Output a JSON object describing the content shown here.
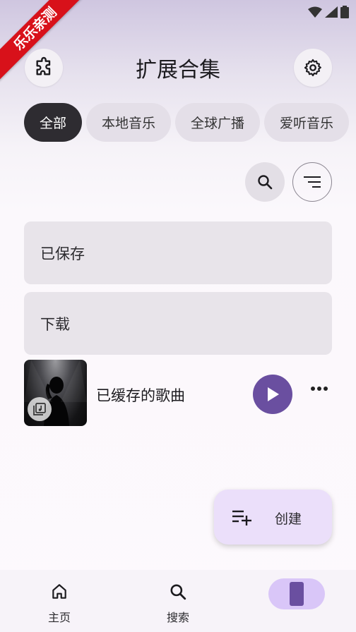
{
  "watermark": {
    "text": "乐乐亲测"
  },
  "header": {
    "title": "扩展合集"
  },
  "tabs": [
    {
      "label": "全部",
      "active": true
    },
    {
      "label": "本地音乐",
      "active": false
    },
    {
      "label": "全球广播",
      "active": false
    },
    {
      "label": "爱听音乐",
      "active": false
    }
  ],
  "icons": {
    "extension": "puzzle-icon",
    "settings": "gear-icon",
    "search": "search-icon",
    "sort": "sort-icon",
    "play": "play-icon",
    "more": "more-horizontal-icon",
    "playlist_add": "playlist-add-icon",
    "home": "home-icon",
    "nav_search": "search-icon",
    "library": "library-icon"
  },
  "cards": [
    {
      "label": "已保存"
    },
    {
      "label": "下载"
    }
  ],
  "cached_song": {
    "title": "已缓存的歌曲"
  },
  "fab": {
    "label": "创建"
  },
  "bottom_nav": {
    "items": [
      {
        "label": "主页"
      },
      {
        "label": "搜索"
      }
    ]
  },
  "colors": {
    "accent": "#6a4fa0",
    "active_chip": "#2e2c31",
    "watermark": "#d8111a",
    "fab_bg": "#ebdffa"
  }
}
